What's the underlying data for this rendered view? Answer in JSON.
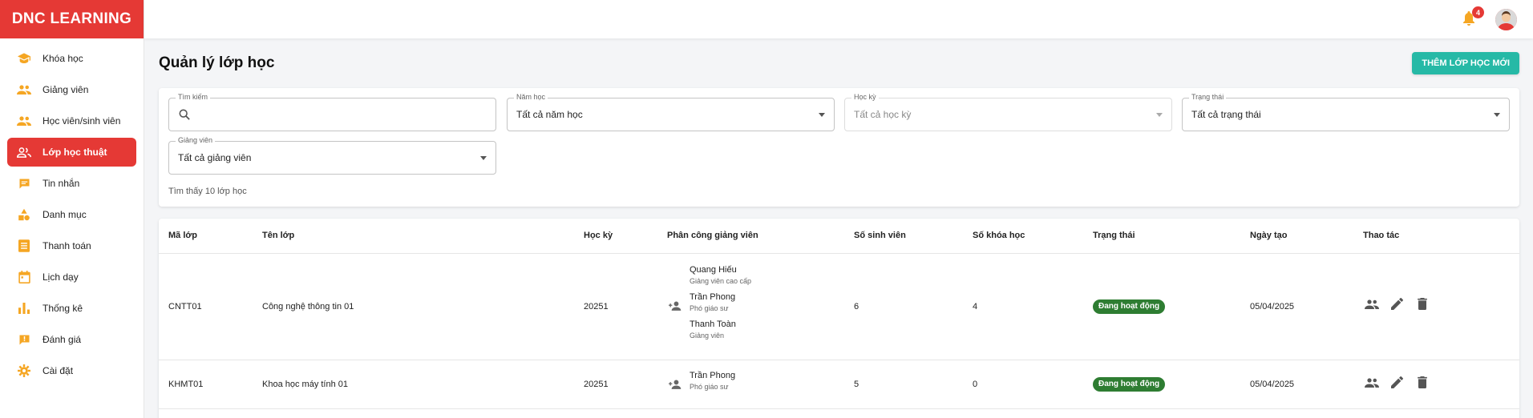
{
  "brand": "DNC LEARNING",
  "sidebar": {
    "items": [
      {
        "label": "Khóa học",
        "icon": "graduation-cap-icon"
      },
      {
        "label": "Giảng viên",
        "icon": "people-icon"
      },
      {
        "label": "Học viên/sinh viên",
        "icon": "people-icon"
      },
      {
        "label": "Lớp học thuật",
        "icon": "people-outline-icon",
        "active": true
      },
      {
        "label": "Tin nhắn",
        "icon": "chat-icon"
      },
      {
        "label": "Danh mục",
        "icon": "category-icon"
      },
      {
        "label": "Thanh toán",
        "icon": "receipt-icon"
      },
      {
        "label": "Lịch dạy",
        "icon": "calendar-icon"
      },
      {
        "label": "Thống kê",
        "icon": "bar-chart-icon"
      },
      {
        "label": "Đánh giá",
        "icon": "feedback-icon"
      },
      {
        "label": "Cài đặt",
        "icon": "gear-icon"
      }
    ]
  },
  "topbar": {
    "notification_count": "4"
  },
  "page": {
    "title": "Quản lý lớp học",
    "add_button": "THÊM LỚP HỌC MỚI"
  },
  "filters": {
    "search_label": "Tìm kiếm",
    "year_label": "Năm học",
    "year_value": "Tất cả năm học",
    "semester_label": "Học kỳ",
    "semester_value": "Tất cả học kỳ",
    "status_label": "Trạng thái",
    "status_value": "Tất cả trạng thái",
    "teacher_label": "Giảng viên",
    "teacher_value": "Tất cả giảng viên",
    "result_text": "Tìm thấy 10 lớp học"
  },
  "table": {
    "columns": [
      "Mã lớp",
      "Tên lớp",
      "Học kỳ",
      "Phân công giảng viên",
      "Số sinh viên",
      "Số khóa học",
      "Trạng thái",
      "Ngày tạo",
      "Thao tác"
    ],
    "rows": [
      {
        "code": "CNTT01",
        "name": "Công nghệ thông tin 01",
        "semester": "20251",
        "teachers": [
          {
            "name": "Quang Hiếu",
            "role": "Giảng viên cao cấp"
          },
          {
            "name": "Trần Phong",
            "role": "Phó giáo sư"
          },
          {
            "name": "Thanh Toàn",
            "role": "Giảng viên"
          }
        ],
        "students": "6",
        "courses": "4",
        "status": "Đang hoạt động",
        "created": "05/04/2025"
      },
      {
        "code": "KHMT01",
        "name": "Khoa học máy tính 01",
        "semester": "20251",
        "teachers": [
          {
            "name": "Trần Phong",
            "role": "Phó giáo sư"
          }
        ],
        "students": "5",
        "courses": "0",
        "status": "Đang hoạt động",
        "created": "05/04/2025"
      }
    ]
  },
  "colors": {
    "brand_red": "#e53935",
    "accent_teal": "#26b9a6",
    "status_green": "#2e7d32",
    "icon_orange": "#f5a623"
  }
}
